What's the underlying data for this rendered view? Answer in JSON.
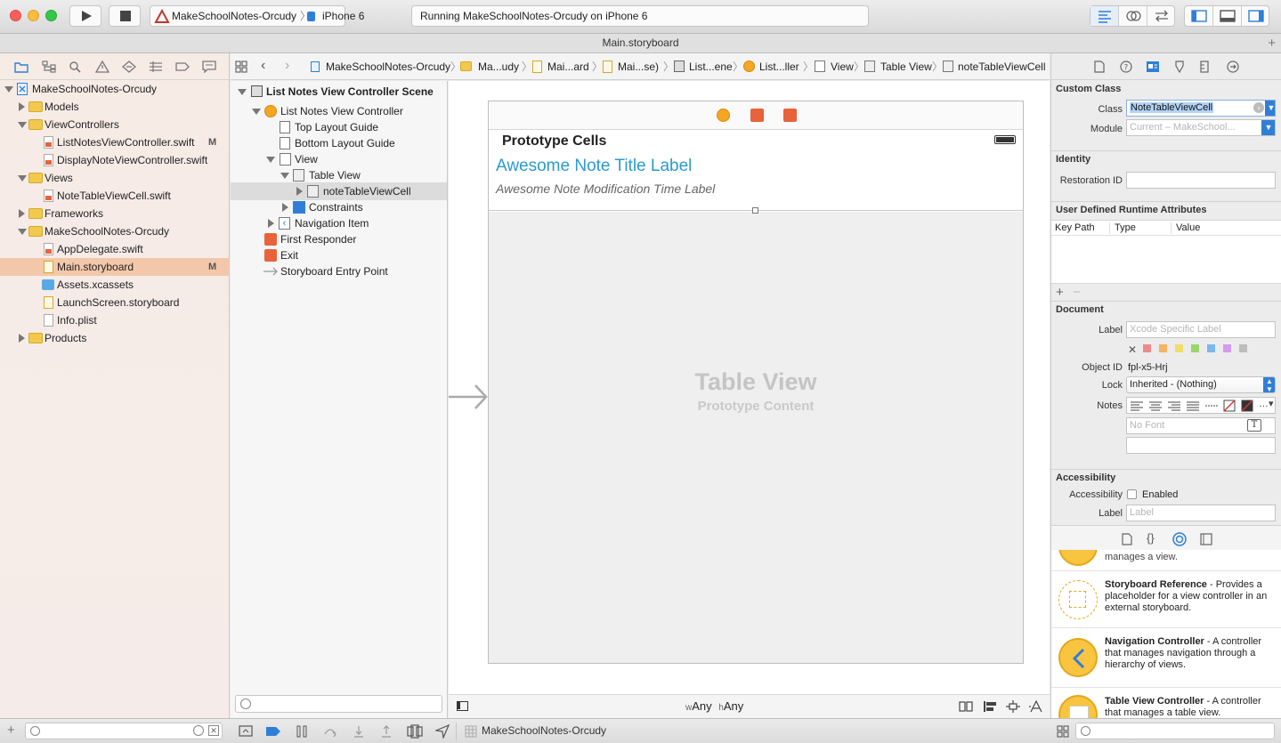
{
  "toolbar": {
    "scheme": "MakeSchoolNotes-Orcudy",
    "device": "iPhone 6",
    "status": "Running MakeSchoolNotes-Orcudy on iPhone 6"
  },
  "tab_title": "Main.storyboard",
  "navigator": {
    "items": [
      {
        "label": "MakeSchoolNotes-Orcudy",
        "badge": ""
      },
      {
        "label": "Models",
        "badge": ""
      },
      {
        "label": "ViewControllers",
        "badge": ""
      },
      {
        "label": "ListNotesViewController.swift",
        "badge": "M"
      },
      {
        "label": "DisplayNoteViewController.swift",
        "badge": ""
      },
      {
        "label": "Views",
        "badge": ""
      },
      {
        "label": "NoteTableViewCell.swift",
        "badge": ""
      },
      {
        "label": "Frameworks",
        "badge": ""
      },
      {
        "label": "MakeSchoolNotes-Orcudy",
        "badge": ""
      },
      {
        "label": "AppDelegate.swift",
        "badge": ""
      },
      {
        "label": "Main.storyboard",
        "badge": "M"
      },
      {
        "label": "Assets.xcassets",
        "badge": ""
      },
      {
        "label": "LaunchScreen.storyboard",
        "badge": ""
      },
      {
        "label": "Info.plist",
        "badge": ""
      },
      {
        "label": "Products",
        "badge": ""
      }
    ]
  },
  "jumpbar": [
    "MakeSchoolNotes-Orcudy",
    "Ma...udy",
    "Mai...ard",
    "Mai...se)",
    "List...ene",
    "List...ller",
    "View",
    "Table View",
    "noteTableViewCell"
  ],
  "outline": {
    "items": [
      "List Notes View Controller Scene",
      "List Notes View Controller",
      "Top Layout Guide",
      "Bottom Layout Guide",
      "View",
      "Table View",
      "noteTableViewCell",
      "Constraints",
      "Navigation Item",
      "First Responder",
      "Exit",
      "Storyboard Entry Point"
    ]
  },
  "canvas": {
    "prototype_header": "Prototype Cells",
    "title_label": "Awesome Note Title Label",
    "time_label": "Awesome Note Modification Time Label",
    "placeholder_title": "Table View",
    "placeholder_sub": "Prototype Content",
    "size_w": "w",
    "size_w_val": "Any",
    "size_h": "h",
    "size_h_val": "Any"
  },
  "inspector": {
    "custom_class_header": "Custom Class",
    "class_label": "Class",
    "class_value": "NoteTableViewCell",
    "module_label": "Module",
    "module_placeholder": "Current – MakeSchool...",
    "identity_header": "Identity",
    "restoration_label": "Restoration ID",
    "udra_header": "User Defined Runtime Attributes",
    "udra_cols": [
      "Key Path",
      "Type",
      "Value"
    ],
    "document_header": "Document",
    "doc_label": "Label",
    "doc_label_placeholder": "Xcode Specific Label",
    "object_id_label": "Object ID",
    "object_id_value": "fpl-x5-Hrj",
    "lock_label": "Lock",
    "lock_value": "Inherited - (Nothing)",
    "notes_label": "Notes",
    "font_placeholder": "No Font",
    "accessibility_header": "Accessibility",
    "accessibility_label": "Accessibility",
    "enabled_label": "Enabled",
    "acc_label": "Label",
    "acc_label_placeholder": "Label",
    "color_swatches": [
      "#f08a8a",
      "#f5b460",
      "#f2dc6a",
      "#9ad66c",
      "#79b8f0",
      "#d49af0",
      "#bdbdbd"
    ]
  },
  "library": {
    "cut_text": "manages a view.",
    "items": [
      {
        "title": "Storyboard Reference",
        "desc": " - Provides a placeholder for a view controller in an external storyboard."
      },
      {
        "title": "Navigation Controller",
        "desc": " - A controller that manages navigation through a hierarchy of views."
      },
      {
        "title": "Table View Controller",
        "desc": " - A controller that manages a table view."
      }
    ]
  },
  "bottombar": {
    "scheme": "MakeSchoolNotes-Orcudy"
  }
}
